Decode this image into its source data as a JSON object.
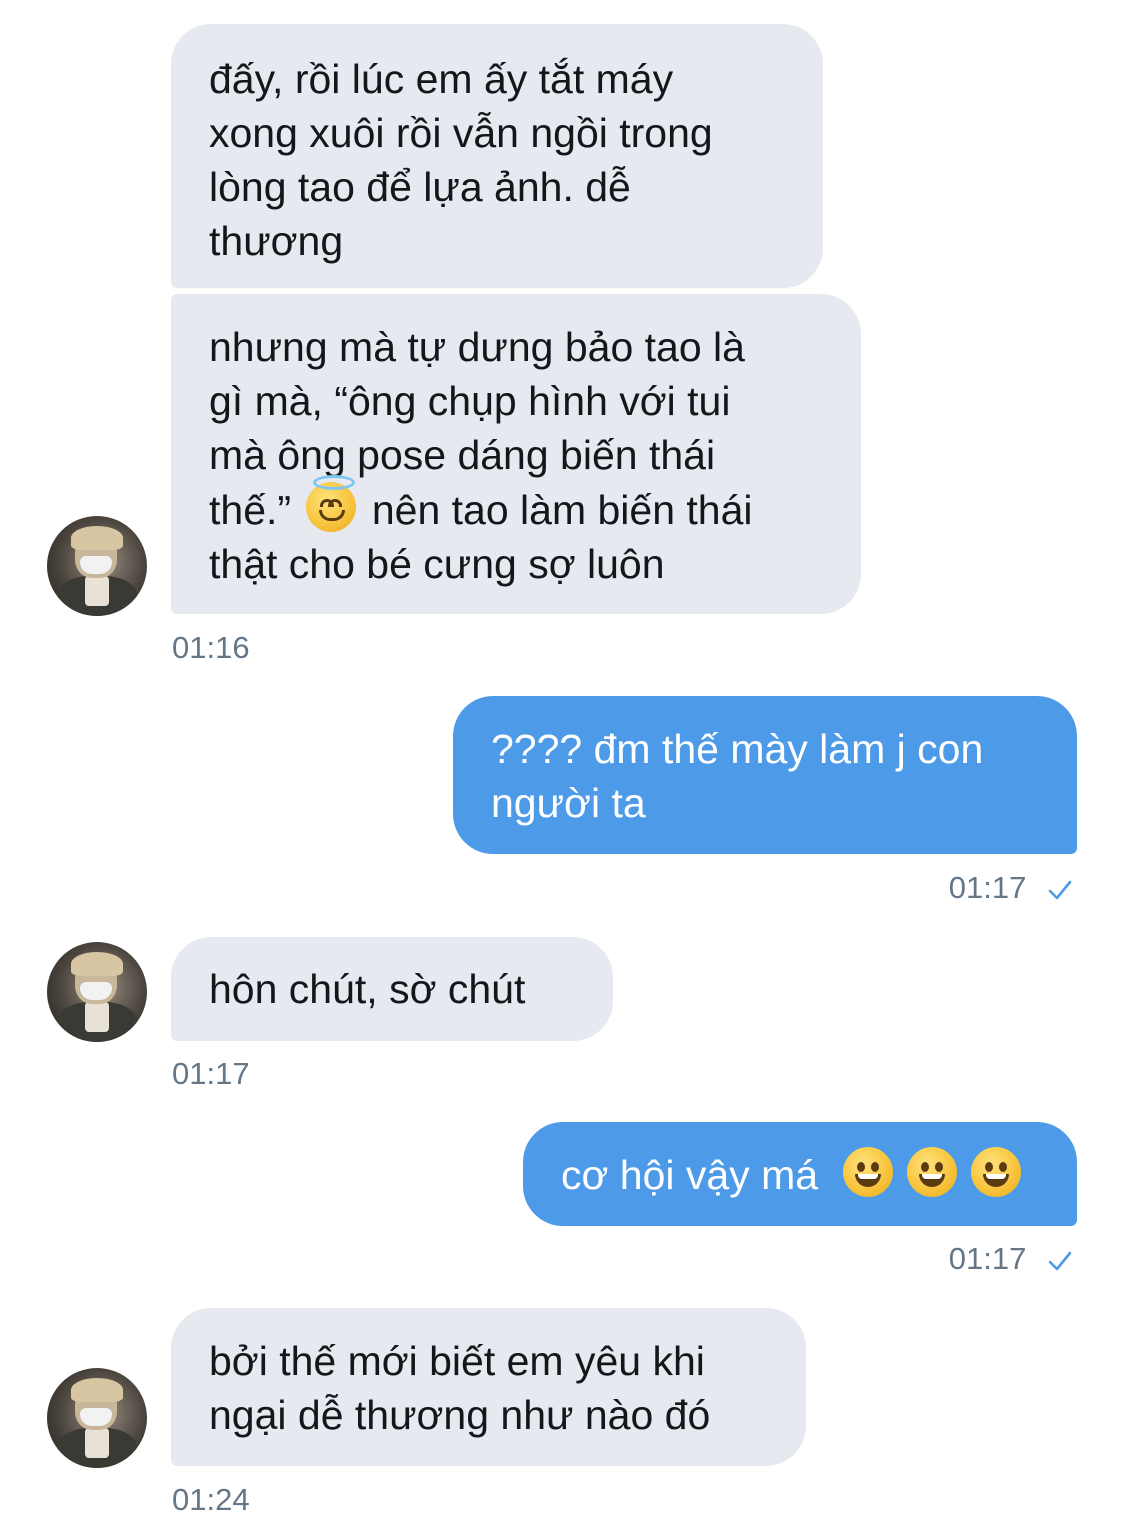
{
  "messages": [
    {
      "id": "m1",
      "direction": "incoming",
      "lines": [
        "đấy, rồi lúc em ấy tắt máy",
        "xong xuôi rồi vẫn ngồi trong",
        "lòng tao để lựa ảnh. dễ",
        "thương"
      ]
    },
    {
      "id": "m2",
      "direction": "incoming",
      "lines": [
        "nhưng mà tự dưng bảo tao là",
        "gì mà, “ông chụp hình với tui",
        "mà ông pose dáng biến thái"
      ],
      "line4_before": "thế.”",
      "emoji": "smiling-face-with-halo",
      "line4_after": "nên tao làm biến thái",
      "line5": "thật cho bé cưng sợ luôn",
      "time": "01:16"
    },
    {
      "id": "m3",
      "direction": "outgoing",
      "lines": [
        "???? đm thế mày làm j con",
        "người ta"
      ],
      "time": "01:17",
      "status_icon": "read-check-icon"
    },
    {
      "id": "m4",
      "direction": "incoming",
      "lines": [
        "hôn chút, sờ chút"
      ],
      "time": "01:17"
    },
    {
      "id": "m5",
      "direction": "outgoing",
      "text": "cơ hội vậy má",
      "emojis": [
        "grinning-face",
        "grinning-face",
        "grinning-face"
      ],
      "time": "01:17",
      "status_icon": "read-check-icon"
    },
    {
      "id": "m6",
      "direction": "incoming",
      "lines": [
        "bởi thế mới biết em yêu khi",
        "ngại dễ thương như nào đó"
      ],
      "time": "01:24"
    }
  ],
  "colors": {
    "incoming_bubble": "#e6e9ef",
    "outgoing_bubble": "#4d9be8",
    "timestamp": "#657786",
    "check": "#4d9be8"
  }
}
